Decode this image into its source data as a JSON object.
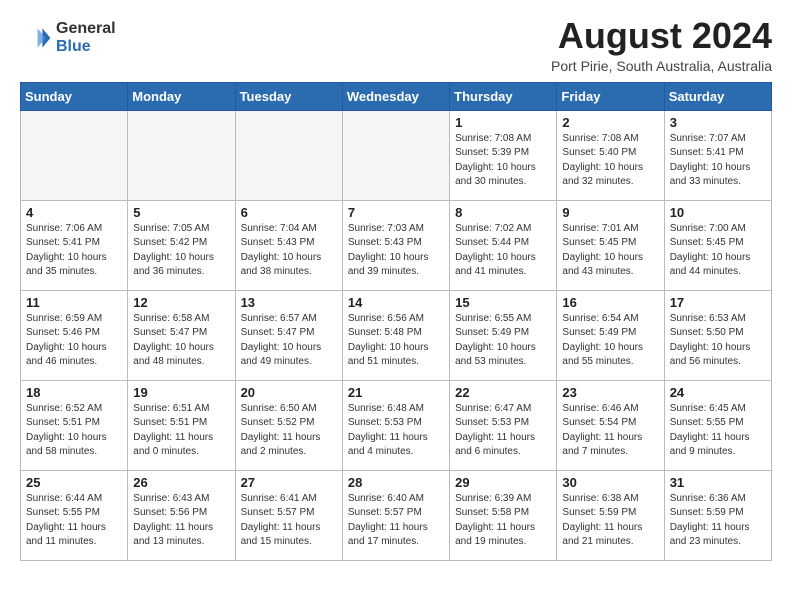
{
  "header": {
    "logo_general": "General",
    "logo_blue": "Blue",
    "month_title": "August 2024",
    "location": "Port Pirie, South Australia, Australia"
  },
  "days_of_week": [
    "Sunday",
    "Monday",
    "Tuesday",
    "Wednesday",
    "Thursday",
    "Friday",
    "Saturday"
  ],
  "weeks": [
    [
      {
        "day": "",
        "info": ""
      },
      {
        "day": "",
        "info": ""
      },
      {
        "day": "",
        "info": ""
      },
      {
        "day": "",
        "info": ""
      },
      {
        "day": "1",
        "info": "Sunrise: 7:08 AM\nSunset: 5:39 PM\nDaylight: 10 hours\nand 30 minutes."
      },
      {
        "day": "2",
        "info": "Sunrise: 7:08 AM\nSunset: 5:40 PM\nDaylight: 10 hours\nand 32 minutes."
      },
      {
        "day": "3",
        "info": "Sunrise: 7:07 AM\nSunset: 5:41 PM\nDaylight: 10 hours\nand 33 minutes."
      }
    ],
    [
      {
        "day": "4",
        "info": "Sunrise: 7:06 AM\nSunset: 5:41 PM\nDaylight: 10 hours\nand 35 minutes."
      },
      {
        "day": "5",
        "info": "Sunrise: 7:05 AM\nSunset: 5:42 PM\nDaylight: 10 hours\nand 36 minutes."
      },
      {
        "day": "6",
        "info": "Sunrise: 7:04 AM\nSunset: 5:43 PM\nDaylight: 10 hours\nand 38 minutes."
      },
      {
        "day": "7",
        "info": "Sunrise: 7:03 AM\nSunset: 5:43 PM\nDaylight: 10 hours\nand 39 minutes."
      },
      {
        "day": "8",
        "info": "Sunrise: 7:02 AM\nSunset: 5:44 PM\nDaylight: 10 hours\nand 41 minutes."
      },
      {
        "day": "9",
        "info": "Sunrise: 7:01 AM\nSunset: 5:45 PM\nDaylight: 10 hours\nand 43 minutes."
      },
      {
        "day": "10",
        "info": "Sunrise: 7:00 AM\nSunset: 5:45 PM\nDaylight: 10 hours\nand 44 minutes."
      }
    ],
    [
      {
        "day": "11",
        "info": "Sunrise: 6:59 AM\nSunset: 5:46 PM\nDaylight: 10 hours\nand 46 minutes."
      },
      {
        "day": "12",
        "info": "Sunrise: 6:58 AM\nSunset: 5:47 PM\nDaylight: 10 hours\nand 48 minutes."
      },
      {
        "day": "13",
        "info": "Sunrise: 6:57 AM\nSunset: 5:47 PM\nDaylight: 10 hours\nand 49 minutes."
      },
      {
        "day": "14",
        "info": "Sunrise: 6:56 AM\nSunset: 5:48 PM\nDaylight: 10 hours\nand 51 minutes."
      },
      {
        "day": "15",
        "info": "Sunrise: 6:55 AM\nSunset: 5:49 PM\nDaylight: 10 hours\nand 53 minutes."
      },
      {
        "day": "16",
        "info": "Sunrise: 6:54 AM\nSunset: 5:49 PM\nDaylight: 10 hours\nand 55 minutes."
      },
      {
        "day": "17",
        "info": "Sunrise: 6:53 AM\nSunset: 5:50 PM\nDaylight: 10 hours\nand 56 minutes."
      }
    ],
    [
      {
        "day": "18",
        "info": "Sunrise: 6:52 AM\nSunset: 5:51 PM\nDaylight: 10 hours\nand 58 minutes."
      },
      {
        "day": "19",
        "info": "Sunrise: 6:51 AM\nSunset: 5:51 PM\nDaylight: 11 hours\nand 0 minutes."
      },
      {
        "day": "20",
        "info": "Sunrise: 6:50 AM\nSunset: 5:52 PM\nDaylight: 11 hours\nand 2 minutes."
      },
      {
        "day": "21",
        "info": "Sunrise: 6:48 AM\nSunset: 5:53 PM\nDaylight: 11 hours\nand 4 minutes."
      },
      {
        "day": "22",
        "info": "Sunrise: 6:47 AM\nSunset: 5:53 PM\nDaylight: 11 hours\nand 6 minutes."
      },
      {
        "day": "23",
        "info": "Sunrise: 6:46 AM\nSunset: 5:54 PM\nDaylight: 11 hours\nand 7 minutes."
      },
      {
        "day": "24",
        "info": "Sunrise: 6:45 AM\nSunset: 5:55 PM\nDaylight: 11 hours\nand 9 minutes."
      }
    ],
    [
      {
        "day": "25",
        "info": "Sunrise: 6:44 AM\nSunset: 5:55 PM\nDaylight: 11 hours\nand 11 minutes."
      },
      {
        "day": "26",
        "info": "Sunrise: 6:43 AM\nSunset: 5:56 PM\nDaylight: 11 hours\nand 13 minutes."
      },
      {
        "day": "27",
        "info": "Sunrise: 6:41 AM\nSunset: 5:57 PM\nDaylight: 11 hours\nand 15 minutes."
      },
      {
        "day": "28",
        "info": "Sunrise: 6:40 AM\nSunset: 5:57 PM\nDaylight: 11 hours\nand 17 minutes."
      },
      {
        "day": "29",
        "info": "Sunrise: 6:39 AM\nSunset: 5:58 PM\nDaylight: 11 hours\nand 19 minutes."
      },
      {
        "day": "30",
        "info": "Sunrise: 6:38 AM\nSunset: 5:59 PM\nDaylight: 11 hours\nand 21 minutes."
      },
      {
        "day": "31",
        "info": "Sunrise: 6:36 AM\nSunset: 5:59 PM\nDaylight: 11 hours\nand 23 minutes."
      }
    ]
  ]
}
